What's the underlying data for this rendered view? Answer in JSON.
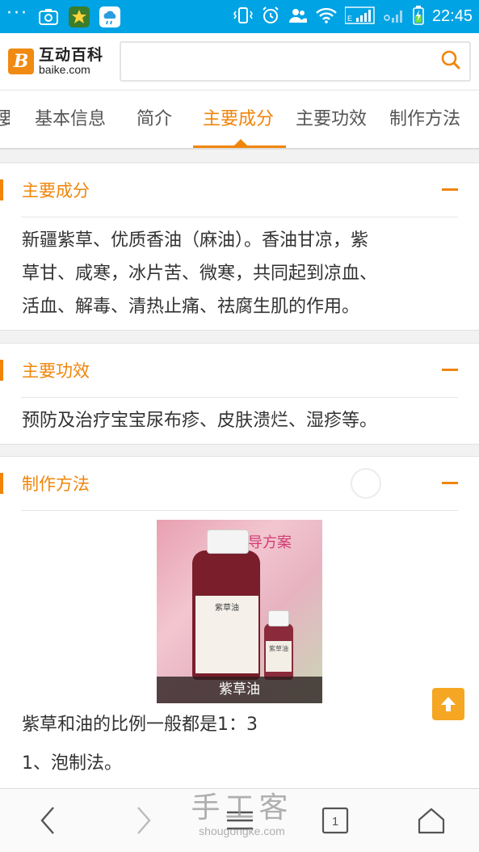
{
  "status_bar": {
    "time": "22:45",
    "network": "E"
  },
  "header": {
    "logo_cn": "互动百科",
    "logo_en": "baike.com",
    "search_placeholder": ""
  },
  "tabs": [
    {
      "label": "要"
    },
    {
      "label": "基本信息"
    },
    {
      "label": "简介"
    },
    {
      "label": "主要成分",
      "active": true
    },
    {
      "label": "主要功效"
    },
    {
      "label": "制作方法"
    }
  ],
  "sections": {
    "ingredients": {
      "title": "主要成分",
      "lines": [
        "新疆紫草、优质香油（麻油）。香油甘凉，紫",
        "草甘、咸寒，冰片苦、微寒，共同起到凉血、",
        "活血、解毒、清热止痛、祛腐生肌的作用。"
      ]
    },
    "efficacy": {
      "title": "主要功效",
      "text": "预防及治疗宝宝尿布疹、皮肤溃烂、湿疹等。"
    },
    "method": {
      "title": "制作方法",
      "figure_caption": "紫草油",
      "figure_banner": "指导方案",
      "bottle_label": "紫草油",
      "small_bottle_label": "紫草油",
      "ratio_text": "紫草和油的比例一般都是1：3",
      "step_text": "1、泡制法。"
    }
  },
  "bottom_nav": {
    "tabs_count": "1"
  },
  "watermark": {
    "cn": "手工客",
    "en": "shougongke.com"
  },
  "colors": {
    "accent": "#f0850a",
    "status_bar": "#00a3e4"
  }
}
